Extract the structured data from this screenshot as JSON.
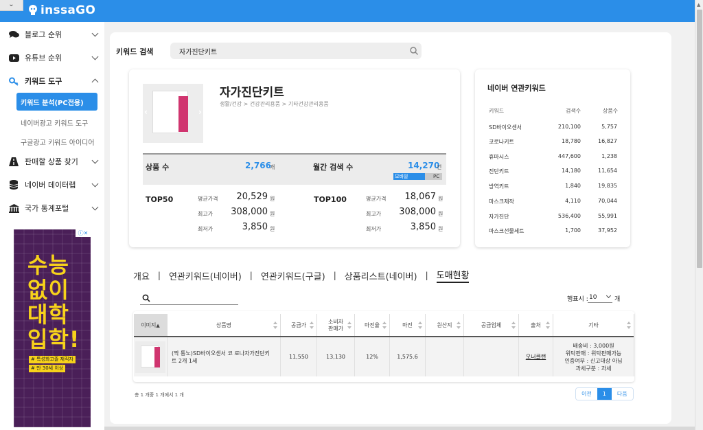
{
  "brand": {
    "logo_text": "inssaGO"
  },
  "sidebar": {
    "items": [
      {
        "label": "블로그 순위",
        "icon": "chat-bubbles-icon"
      },
      {
        "label": "유튜브 순위",
        "icon": "youtube-play-icon"
      },
      {
        "label": "키워드 도구",
        "icon": "key-icon"
      },
      {
        "label": "판매할 상품 찾기",
        "icon": "road-icon"
      },
      {
        "label": "네이버 데이터랩",
        "icon": "database-icon"
      },
      {
        "label": "국가 통계포털",
        "icon": "institution-icon"
      }
    ],
    "sub_items": [
      "키워드 분석(PC전용)",
      "네이버광고 키워드 도구",
      "구글광고 키워드 아이디어"
    ]
  },
  "ad": {
    "headline_lines": [
      "수능",
      "없이",
      "대학",
      "입학!"
    ],
    "tags": [
      "# 특성화고졸 재직자",
      "# 만 30세 이상"
    ]
  },
  "search": {
    "label": "키워드 검색",
    "value": "자가진단키트"
  },
  "product": {
    "title": "자가진단키트",
    "category": "생활/건강 > 건강관리용품 > 기타건강관리용품",
    "count_label": "상품 수",
    "count_value": "2,766",
    "count_unit": "개",
    "monthly_label": "월간 검색 수",
    "monthly_value": "14,270",
    "monthly_unit": "건",
    "mobile_label": "모바일",
    "pc_label": "PC",
    "top50": {
      "label": "TOP50",
      "avg_label": "평균가격",
      "avg": "20,529",
      "max_label": "최고가",
      "max": "308,000",
      "min_label": "최저가",
      "min": "3,850",
      "unit": "원"
    },
    "top100": {
      "label": "TOP100",
      "avg_label": "평균가격",
      "avg": "18,067",
      "max_label": "최고가",
      "max": "308,000",
      "min_label": "최저가",
      "min": "3,850",
      "unit": "원"
    }
  },
  "related": {
    "title": "네이버 연관키워드",
    "headers": [
      "키워드",
      "검색수",
      "상품수"
    ],
    "rows": [
      [
        "SD바이오센서",
        "210,100",
        "5,757"
      ],
      [
        "코로나키트",
        "18,780",
        "16,827"
      ],
      [
        "휴마시스",
        "447,600",
        "1,238"
      ],
      [
        "진단키트",
        "14,180",
        "11,654"
      ],
      [
        "방역키트",
        "1,840",
        "19,835"
      ],
      [
        "마스크제작",
        "4,110",
        "70,044"
      ],
      [
        "자가진단",
        "536,400",
        "55,991"
      ],
      [
        "마스크선물세트",
        "1,700",
        "37,952"
      ]
    ]
  },
  "tabs": [
    "개요",
    "연관키워드(네이버)",
    "연관키워드(구글)",
    "상품리스트(네이버)",
    "도매현황"
  ],
  "active_tab": 4,
  "table": {
    "rows_label": "행표시 :",
    "rows_value": "10",
    "rows_unit": "개",
    "headers": [
      "이미지",
      "상품명",
      "공급가",
      "소비자 판매가",
      "마진율",
      "마진",
      "원산지",
      "공급업체",
      "출처",
      "기타"
    ],
    "row": {
      "name": "(짝 통노)SD바이오센서 코 로나자가진단키 트 2개 1세",
      "supply": "11,550",
      "retail": "13,130",
      "margin_rate": "12%",
      "margin": "1,575.6",
      "origin": "",
      "supplier": "",
      "source": "오너클랜",
      "etc": [
        "배송비 : 3,000원",
        "위탁판매 : 위탁판매가능",
        "인증여부 : 신고대상 아님",
        "과세구분 : 과세"
      ]
    },
    "footer": "총 1 개중 1 개에서 1 개",
    "pager": {
      "prev": "이전",
      "current": "1",
      "next": "다음"
    }
  },
  "colors": {
    "accent": "#2b8ee8",
    "ad_bg": "#4a1f58",
    "ad_text": "#f7d21b"
  }
}
